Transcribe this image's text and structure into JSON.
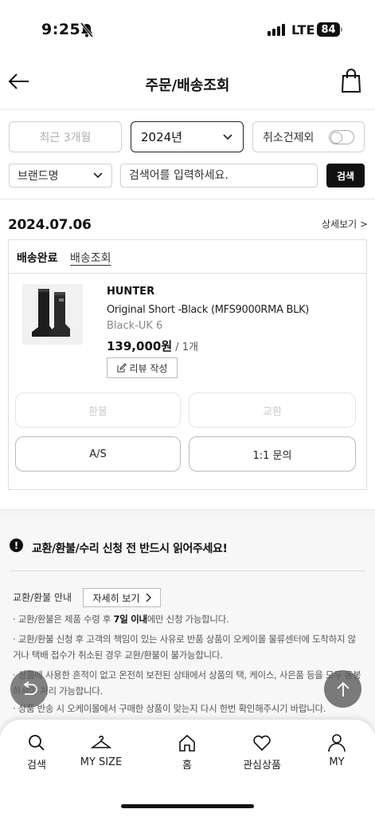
{
  "status_bar": {
    "time": "9:25",
    "network": "LTE",
    "battery": "84"
  },
  "header": {
    "title": "주문/배송조회"
  },
  "filters": {
    "period_label": "최근 3개월",
    "year_value": "2024년",
    "cancel_toggle_label": "취소건제외",
    "brand_select_label": "브랜드명",
    "search_placeholder": "검색어를 입력하세요.",
    "search_button": "검색"
  },
  "order": {
    "date": "2024.07.06",
    "detail_link": "상세보기 >",
    "status": "배송완료",
    "track_link": "배송조회",
    "item": {
      "brand": "HUNTER",
      "name": "Original Short -Black (MFS9000RMA BLK)",
      "option": "Black-UK 6",
      "price": "139,000원",
      "quantity": " / 1개",
      "review_button": "리뷰 작성"
    },
    "actions": {
      "refund": "환불",
      "exchange": "교환",
      "as": "A/S",
      "inquiry": "1:1 문의"
    }
  },
  "notice": {
    "title": "교환/환불/수리 신청 전 반드시 읽어주세요!",
    "guide_label": "교환/환불 안내",
    "guide_more": "자세히 보기",
    "line1_prefix": "· 교환/환불은 제품 수령 후 ",
    "line1_bold": "7일 이내",
    "line1_suffix": "에만 신청 가능합니다.",
    "line2": "· 교환/환불 신청 후 고객의 책임이 있는 사유로 반품 상품이 오케이몰 물류센터에 도착하지 않거나 택배 접수가 취소된 경우 교환/환불이 불가능합니다.",
    "line3": "· 상품에 사용한 흔적이 없고 온전히 보전된 상태에서 상품의 택, 케이스, 사은품 등을 모두 동봉하셔야 처리 가능합니다.",
    "line4": "· 상품 반송 시 오케이몰에서 구매한 상품이 맞는지 다시 한번 확인해주시기 바랍니다."
  },
  "bottom_nav": {
    "search": "검색",
    "mysize": "MY SIZE",
    "home": "홈",
    "wishlist": "관심상품",
    "my": "MY"
  }
}
